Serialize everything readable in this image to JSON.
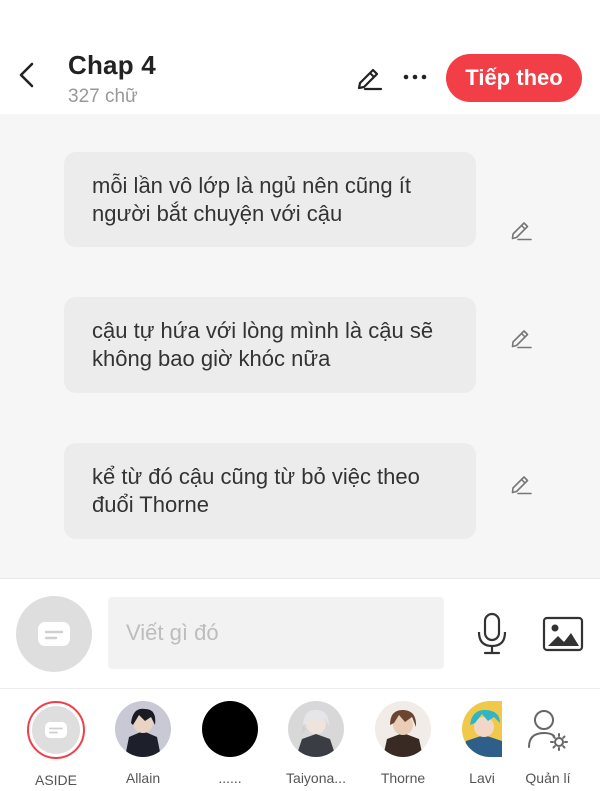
{
  "header": {
    "title": "Chap 4",
    "subtitle": "327 chữ",
    "next_label": "Tiếp theo"
  },
  "messages": [
    {
      "text": "mỗi lần vô lớp là ngủ nên cũng ít người bắt chuyện với cậu"
    },
    {
      "text": "cậu tự hứa với lòng mình là cậu sẽ không bao giờ khóc nữa"
    },
    {
      "text": "kể từ đó cậu cũng từ bỏ việc theo đuổi Thorne"
    }
  ],
  "composer": {
    "placeholder": "Viết gì đó"
  },
  "characters": [
    {
      "name": "ASIDE",
      "icon": "chat-bubble-icon"
    },
    {
      "name": "Allain",
      "icon": "avatar"
    },
    {
      "name": "......",
      "icon": "avatar"
    },
    {
      "name": "Taiyona...",
      "icon": "avatar"
    },
    {
      "name": "Thorne",
      "icon": "avatar"
    },
    {
      "name": "Lavi",
      "icon": "avatar"
    },
    {
      "name": "Quản lí",
      "icon": "manage-user-icon"
    }
  ],
  "colors": {
    "accent": "#f23f47",
    "bubble": "#ececec",
    "background": "#f6f6f6"
  }
}
